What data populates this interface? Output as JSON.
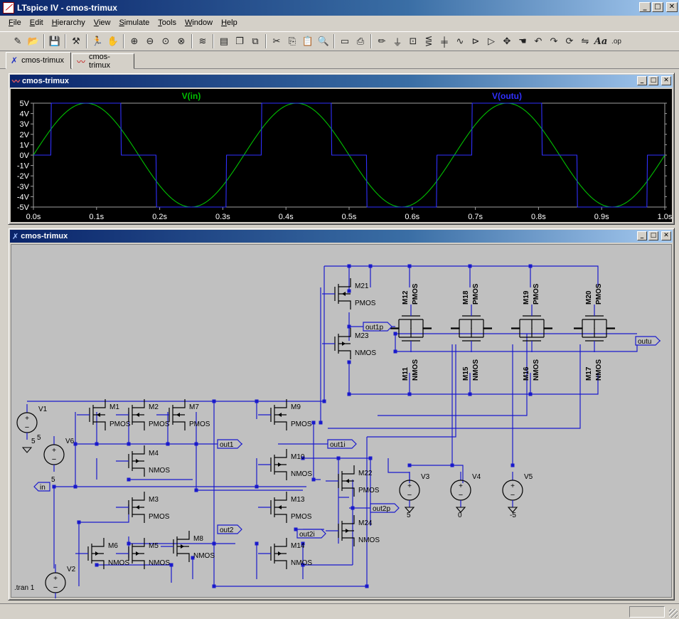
{
  "window": {
    "title": "LTspice IV - cmos-trimux",
    "app_icon_glyph": "IV"
  },
  "menu": [
    "File",
    "Edit",
    "Hierarchy",
    "View",
    "Simulate",
    "Tools",
    "Window",
    "Help"
  ],
  "toolbar_icons": [
    "new-schematic-icon",
    "open-icon",
    "sep",
    "save-icon",
    "sep",
    "control-panel-icon",
    "sep",
    "run-icon",
    "halt-icon",
    "sep",
    "zoom-in-icon",
    "zoom-out-icon",
    "zoom-fit-icon",
    "zoom-cancel-icon",
    "sep",
    "plot-settings-icon",
    "sep",
    "tile-horizontal-icon",
    "cascade-icon",
    "close-windows-icon",
    "sep",
    "cut-icon",
    "copy-icon",
    "paste-icon",
    "find-icon",
    "sep",
    "print-preview-icon",
    "print-icon",
    "sep",
    "draw-wire-icon",
    "ground-icon",
    "label-net-icon",
    "resistor-icon",
    "capacitor-icon",
    "inductor-icon",
    "diode-icon",
    "component-icon",
    "move-icon",
    "drag-icon",
    "undo-icon",
    "redo-icon",
    "rotate-icon",
    "mirror-icon",
    "text-icon",
    "spice-directive-icon"
  ],
  "tabs": [
    {
      "label": "cmos-trimux",
      "kind": "schematic"
    },
    {
      "label": "cmos-trimux",
      "kind": "waveform"
    }
  ],
  "waveform_window": {
    "title": "cmos-trimux"
  },
  "schematic_window": {
    "title": "cmos-trimux"
  },
  "chart_data": {
    "type": "line",
    "series": [
      {
        "name": "V(in)",
        "color": "#00c000"
      },
      {
        "name": "V(outu)",
        "color": "#3030ff"
      }
    ],
    "x_ticks": [
      "0.0s",
      "0.1s",
      "0.2s",
      "0.3s",
      "0.4s",
      "0.5s",
      "0.6s",
      "0.7s",
      "0.8s",
      "0.9s",
      "1.0s"
    ],
    "y_ticks": [
      "5V",
      "4V",
      "3V",
      "2V",
      "1V",
      "0V",
      "-1V",
      "-2V",
      "-3V",
      "-4V",
      "-5V"
    ],
    "xlim": [
      0,
      1.0
    ],
    "ylim": [
      -5,
      5
    ],
    "v_in": {
      "function": "SINE",
      "offset": 0,
      "amplitude": 5,
      "frequency_hz": 3
    },
    "v_outu_levels": [
      -5,
      0,
      5
    ],
    "grid": false,
    "background": "#000000"
  },
  "schematic": {
    "transistors": [
      {
        "name": "M1",
        "type": "PMOS"
      },
      {
        "name": "M2",
        "type": "PMOS"
      },
      {
        "name": "M7",
        "type": "PMOS"
      },
      {
        "name": "M4",
        "type": "NMOS"
      },
      {
        "name": "M3",
        "type": "PMOS"
      },
      {
        "name": "M6",
        "type": "NMOS"
      },
      {
        "name": "M5",
        "type": "NMOS"
      },
      {
        "name": "M8",
        "type": "NMOS"
      },
      {
        "name": "M9",
        "type": "PMOS"
      },
      {
        "name": "M10",
        "type": "NMOS"
      },
      {
        "name": "M13",
        "type": "PMOS"
      },
      {
        "name": "M14",
        "type": "NMOS"
      },
      {
        "name": "M21",
        "type": "PMOS"
      },
      {
        "name": "M23",
        "type": "NMOS"
      },
      {
        "name": "M22",
        "type": "PMOS"
      },
      {
        "name": "M24",
        "type": "NMOS"
      },
      {
        "name": "M12",
        "type": "PMOS"
      },
      {
        "name": "M18",
        "type": "PMOS"
      },
      {
        "name": "M19",
        "type": "PMOS"
      },
      {
        "name": "M20",
        "type": "PMOS"
      },
      {
        "name": "M11",
        "type": "NMOS"
      },
      {
        "name": "M15",
        "type": "NMOS"
      },
      {
        "name": "M16",
        "type": "NMOS"
      },
      {
        "name": "M17",
        "type": "NMOS"
      }
    ],
    "sources": [
      {
        "name": "V1",
        "value": "5"
      },
      {
        "name": "V6",
        "value": "5"
      },
      {
        "name": "V2",
        "value": "SINE(0 5 3)"
      },
      {
        "name": "V3",
        "value": "5"
      },
      {
        "name": "V4",
        "value": "0"
      },
      {
        "name": "V5",
        "value": "-5"
      }
    ],
    "net_labels": [
      "in",
      "out1",
      "out1i",
      "out2",
      "out2i",
      "out1p",
      "out2p",
      "outu"
    ],
    "directive": ".tran 1"
  }
}
